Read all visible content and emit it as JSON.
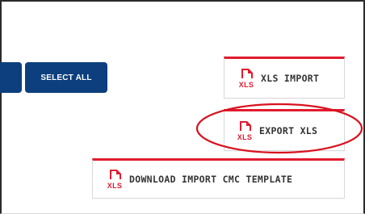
{
  "toolbar": {
    "select_all_label": "SELECT ALL",
    "xls_import_label": "XLS IMPORT",
    "export_xls_label": "EXPORT XLS",
    "download_template_label": "DOWNLOAD IMPORT CMC TEMPLATE"
  },
  "icons": {
    "file_icon": "xls-file-icon",
    "file_icon_text": "XLS"
  },
  "colors": {
    "primary_blue": "#0d3f7e",
    "accent_red": "#e21b2e",
    "annotation_red": "#d9121f",
    "button_border": "#d9d9d9",
    "text_dark": "#333333"
  }
}
